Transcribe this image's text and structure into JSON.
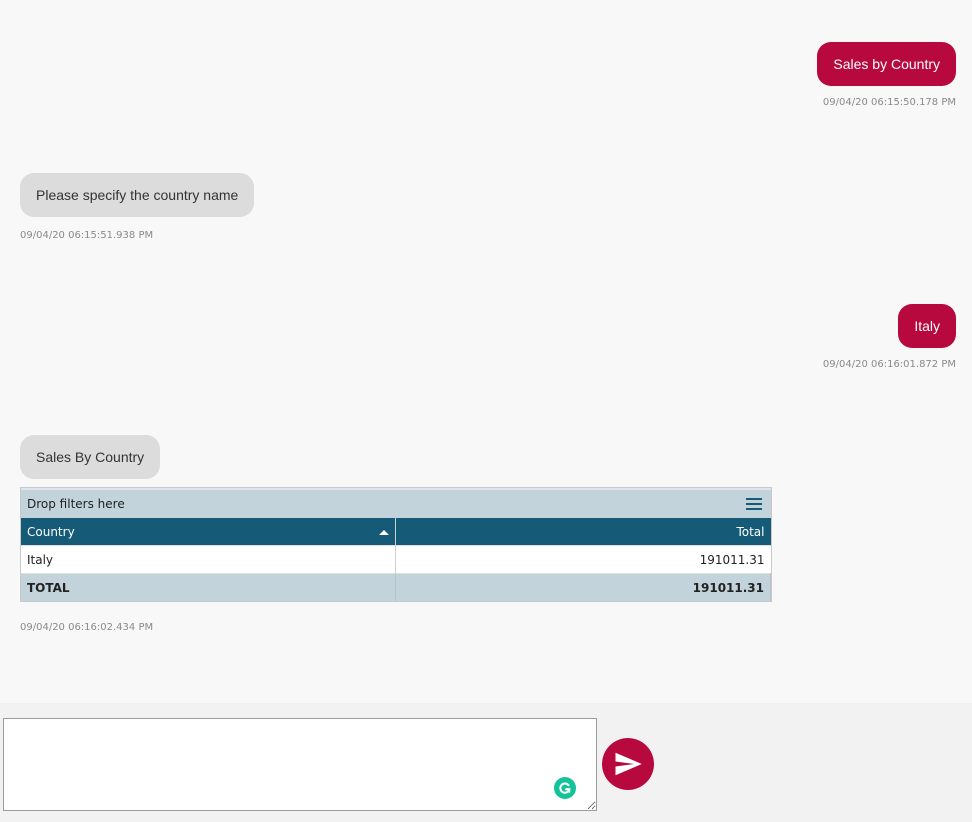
{
  "messages": [
    {
      "sender": "user",
      "text": "Sales by Country",
      "timestamp": "09/04/20 06:15:50.178 PM"
    },
    {
      "sender": "bot",
      "text": "Please specify the country name",
      "timestamp": "09/04/20 06:15:51.938 PM"
    },
    {
      "sender": "user",
      "text": "Italy",
      "timestamp": "09/04/20 06:16:01.872 PM"
    },
    {
      "sender": "bot",
      "text": "Sales By Country",
      "timestamp": "09/04/20 06:16:02.434 PM"
    }
  ],
  "pivot": {
    "filters_placeholder": "Drop filters here",
    "columns": [
      "Country",
      "Total"
    ],
    "rows": [
      {
        "country": "Italy",
        "total": "191011.31"
      }
    ],
    "total_row": {
      "label": "TOTAL",
      "total": "191011.31"
    }
  },
  "composer": {
    "placeholder": "",
    "value": ""
  },
  "icons": {
    "menu": "hamburger-menu-icon",
    "sort": "sort-ascending-icon",
    "grammarly": "grammarly-icon",
    "send": "send-icon"
  },
  "colors": {
    "user_bubble": "#b8093f",
    "bot_bubble": "#dcdcdc",
    "grid_header": "#155b78",
    "grid_band": "#c2d3db",
    "send_button": "#b8093f"
  }
}
